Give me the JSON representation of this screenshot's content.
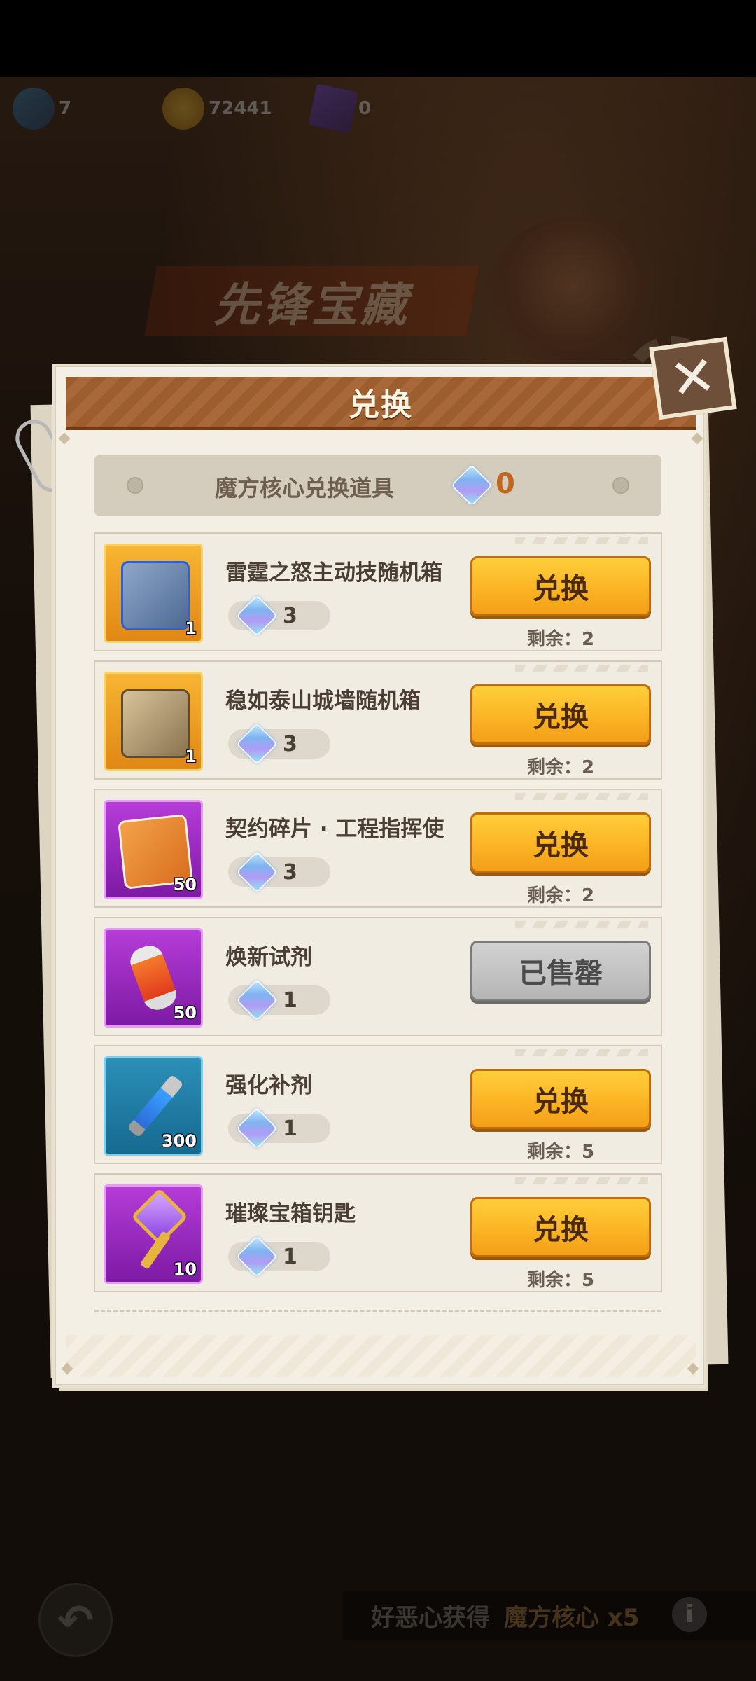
{
  "background": {
    "currencies": [
      {
        "icon": "crystal-pack-icon",
        "value": "7"
      },
      {
        "icon": "gold-coin-icon",
        "value": "72441"
      },
      {
        "icon": "badge-card-icon",
        "value": "0"
      }
    ],
    "event_title": "先锋宝藏",
    "bottom": {
      "text": "好恶心获得",
      "highlight": "魔方核心 x5",
      "info": "i",
      "back_symbol": "↶"
    }
  },
  "dialog": {
    "title": "兑换",
    "close_symbol": "✕",
    "subheader": {
      "label": "魔方核心兑换道具",
      "currency_icon": "cube-core-gem-icon",
      "count": "0"
    },
    "items": [
      {
        "name": "雷霆之怒主动技随机箱",
        "icon": "thunder-chest-icon",
        "frame": "gold",
        "quantity": "1",
        "cost": "3",
        "button": "兑换",
        "remaining": "剩余：2",
        "sold_out": false
      },
      {
        "name": "稳如泰山城墙随机箱",
        "icon": "wall-chest-icon",
        "frame": "gold",
        "quantity": "1",
        "cost": "3",
        "button": "兑换",
        "remaining": "剩余：2",
        "sold_out": false
      },
      {
        "name": "契约碎片 · 工程指挥使",
        "icon": "contract-fragment-icon",
        "frame": "purple",
        "quantity": "50",
        "cost": "3",
        "button": "兑换",
        "remaining": "剩余：2",
        "sold_out": false
      },
      {
        "name": "焕新试剂",
        "icon": "renewal-reagent-icon",
        "frame": "purple",
        "quantity": "50",
        "cost": "1",
        "button": "已售罄",
        "remaining": "",
        "sold_out": true
      },
      {
        "name": "强化补剂",
        "icon": "syringe-icon",
        "frame": "blue",
        "quantity": "300",
        "cost": "1",
        "button": "兑换",
        "remaining": "剩余：5",
        "sold_out": false
      },
      {
        "name": "璀璨宝箱钥匙",
        "icon": "key-icon",
        "frame": "purple",
        "quantity": "10",
        "cost": "1",
        "button": "兑换",
        "remaining": "剩余：5",
        "sold_out": false
      }
    ]
  },
  "colors": {
    "button_active": "#fbb424",
    "button_sold": "#b5b5b5",
    "currency_count": "#c0661e",
    "header": "#9d5e2e"
  }
}
